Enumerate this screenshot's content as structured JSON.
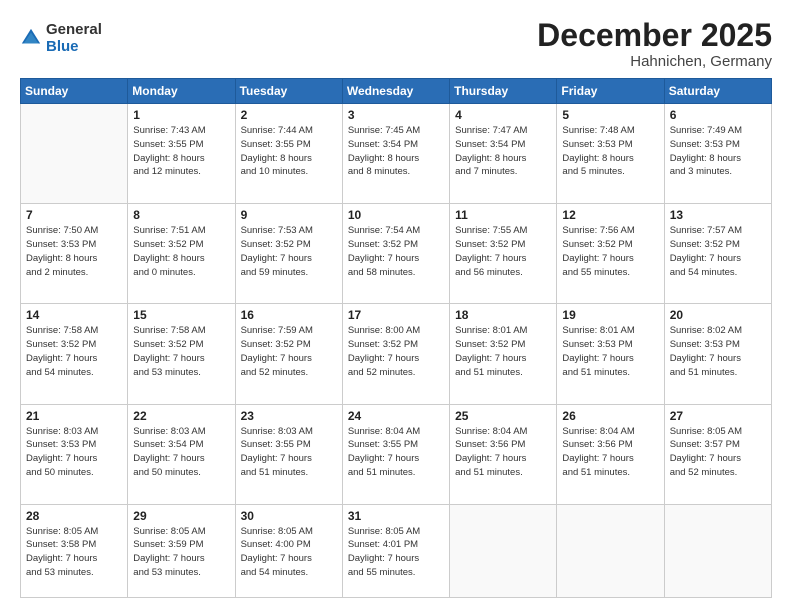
{
  "logo": {
    "general": "General",
    "blue": "Blue"
  },
  "header": {
    "month": "December 2025",
    "location": "Hahnichen, Germany"
  },
  "days_of_week": [
    "Sunday",
    "Monday",
    "Tuesday",
    "Wednesday",
    "Thursday",
    "Friday",
    "Saturday"
  ],
  "weeks": [
    [
      {
        "day": "",
        "info": ""
      },
      {
        "day": "1",
        "info": "Sunrise: 7:43 AM\nSunset: 3:55 PM\nDaylight: 8 hours\nand 12 minutes."
      },
      {
        "day": "2",
        "info": "Sunrise: 7:44 AM\nSunset: 3:55 PM\nDaylight: 8 hours\nand 10 minutes."
      },
      {
        "day": "3",
        "info": "Sunrise: 7:45 AM\nSunset: 3:54 PM\nDaylight: 8 hours\nand 8 minutes."
      },
      {
        "day": "4",
        "info": "Sunrise: 7:47 AM\nSunset: 3:54 PM\nDaylight: 8 hours\nand 7 minutes."
      },
      {
        "day": "5",
        "info": "Sunrise: 7:48 AM\nSunset: 3:53 PM\nDaylight: 8 hours\nand 5 minutes."
      },
      {
        "day": "6",
        "info": "Sunrise: 7:49 AM\nSunset: 3:53 PM\nDaylight: 8 hours\nand 3 minutes."
      }
    ],
    [
      {
        "day": "7",
        "info": "Sunrise: 7:50 AM\nSunset: 3:53 PM\nDaylight: 8 hours\nand 2 minutes."
      },
      {
        "day": "8",
        "info": "Sunrise: 7:51 AM\nSunset: 3:52 PM\nDaylight: 8 hours\nand 0 minutes."
      },
      {
        "day": "9",
        "info": "Sunrise: 7:53 AM\nSunset: 3:52 PM\nDaylight: 7 hours\nand 59 minutes."
      },
      {
        "day": "10",
        "info": "Sunrise: 7:54 AM\nSunset: 3:52 PM\nDaylight: 7 hours\nand 58 minutes."
      },
      {
        "day": "11",
        "info": "Sunrise: 7:55 AM\nSunset: 3:52 PM\nDaylight: 7 hours\nand 56 minutes."
      },
      {
        "day": "12",
        "info": "Sunrise: 7:56 AM\nSunset: 3:52 PM\nDaylight: 7 hours\nand 55 minutes."
      },
      {
        "day": "13",
        "info": "Sunrise: 7:57 AM\nSunset: 3:52 PM\nDaylight: 7 hours\nand 54 minutes."
      }
    ],
    [
      {
        "day": "14",
        "info": "Sunrise: 7:58 AM\nSunset: 3:52 PM\nDaylight: 7 hours\nand 54 minutes."
      },
      {
        "day": "15",
        "info": "Sunrise: 7:58 AM\nSunset: 3:52 PM\nDaylight: 7 hours\nand 53 minutes."
      },
      {
        "day": "16",
        "info": "Sunrise: 7:59 AM\nSunset: 3:52 PM\nDaylight: 7 hours\nand 52 minutes."
      },
      {
        "day": "17",
        "info": "Sunrise: 8:00 AM\nSunset: 3:52 PM\nDaylight: 7 hours\nand 52 minutes."
      },
      {
        "day": "18",
        "info": "Sunrise: 8:01 AM\nSunset: 3:52 PM\nDaylight: 7 hours\nand 51 minutes."
      },
      {
        "day": "19",
        "info": "Sunrise: 8:01 AM\nSunset: 3:53 PM\nDaylight: 7 hours\nand 51 minutes."
      },
      {
        "day": "20",
        "info": "Sunrise: 8:02 AM\nSunset: 3:53 PM\nDaylight: 7 hours\nand 51 minutes."
      }
    ],
    [
      {
        "day": "21",
        "info": "Sunrise: 8:03 AM\nSunset: 3:53 PM\nDaylight: 7 hours\nand 50 minutes."
      },
      {
        "day": "22",
        "info": "Sunrise: 8:03 AM\nSunset: 3:54 PM\nDaylight: 7 hours\nand 50 minutes."
      },
      {
        "day": "23",
        "info": "Sunrise: 8:03 AM\nSunset: 3:55 PM\nDaylight: 7 hours\nand 51 minutes."
      },
      {
        "day": "24",
        "info": "Sunrise: 8:04 AM\nSunset: 3:55 PM\nDaylight: 7 hours\nand 51 minutes."
      },
      {
        "day": "25",
        "info": "Sunrise: 8:04 AM\nSunset: 3:56 PM\nDaylight: 7 hours\nand 51 minutes."
      },
      {
        "day": "26",
        "info": "Sunrise: 8:04 AM\nSunset: 3:56 PM\nDaylight: 7 hours\nand 51 minutes."
      },
      {
        "day": "27",
        "info": "Sunrise: 8:05 AM\nSunset: 3:57 PM\nDaylight: 7 hours\nand 52 minutes."
      }
    ],
    [
      {
        "day": "28",
        "info": "Sunrise: 8:05 AM\nSunset: 3:58 PM\nDaylight: 7 hours\nand 53 minutes."
      },
      {
        "day": "29",
        "info": "Sunrise: 8:05 AM\nSunset: 3:59 PM\nDaylight: 7 hours\nand 53 minutes."
      },
      {
        "day": "30",
        "info": "Sunrise: 8:05 AM\nSunset: 4:00 PM\nDaylight: 7 hours\nand 54 minutes."
      },
      {
        "day": "31",
        "info": "Sunrise: 8:05 AM\nSunset: 4:01 PM\nDaylight: 7 hours\nand 55 minutes."
      },
      {
        "day": "",
        "info": ""
      },
      {
        "day": "",
        "info": ""
      },
      {
        "day": "",
        "info": ""
      }
    ]
  ]
}
